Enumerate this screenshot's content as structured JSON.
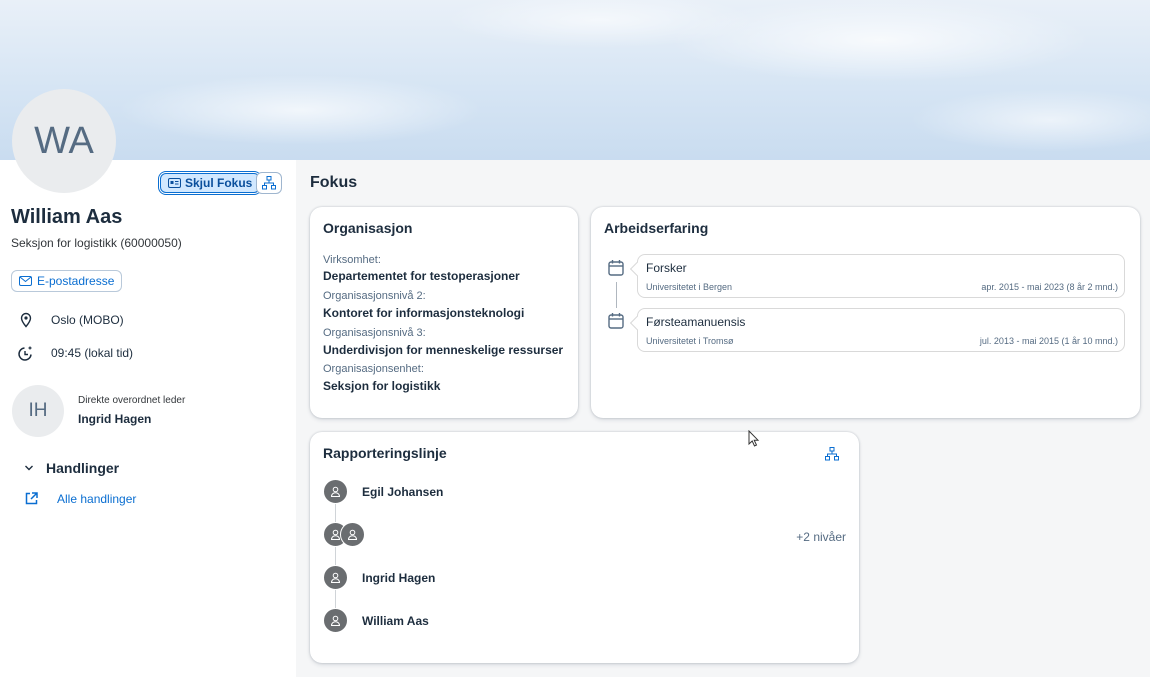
{
  "profile": {
    "initials": "WA",
    "name": "William Aas",
    "unit": "Seksjon for logistikk (60000050)",
    "focus_toggle_label": "Skjul Fokus",
    "email_label": "E-postadresse",
    "location": "Oslo (MOBO)",
    "local_time": "09:45 (lokal tid)",
    "manager": {
      "initials": "IH",
      "label": "Direkte overordnet leder",
      "name": "Ingrid Hagen"
    },
    "actions": {
      "heading": "Handlinger",
      "all_actions": "Alle handlinger"
    }
  },
  "focus": {
    "title": "Fokus",
    "organisation": {
      "title": "Organisasjon",
      "fields": [
        {
          "label": "Virksomhet:",
          "value": "Departementet for testoperasjoner"
        },
        {
          "label": "Organisasjonsnivå 2:",
          "value": "Kontoret for informasjonsteknologi"
        },
        {
          "label": "Organisasjonsnivå 3:",
          "value": "Underdivisjon for menneskelige ressurser"
        },
        {
          "label": "Organisasjonsenhet:",
          "value": "Seksjon for logistikk"
        }
      ]
    },
    "experience": {
      "title": "Arbeidserfaring",
      "items": [
        {
          "role": "Forsker",
          "org": "Universitetet i Bergen",
          "period": "apr. 2015 - mai 2023 (8 år 2 mnd.)"
        },
        {
          "role": "Førsteamanuensis",
          "org": "Universitetet i Tromsø",
          "period": "jul. 2013 - mai 2015 (1 år 10 mnd.)"
        }
      ]
    },
    "reporting_line": {
      "title": "Rapporteringslinje",
      "top": "Egil Johansen",
      "more_levels": "+2 nivåer",
      "manager": "Ingrid Hagen",
      "self": "William Aas"
    }
  },
  "colors": {
    "accent": "#0a6ed1",
    "text": "#1d2d3e",
    "muted": "#556b82",
    "avatar_bg": "#eaecee",
    "person_icon": "#6a6d70"
  }
}
